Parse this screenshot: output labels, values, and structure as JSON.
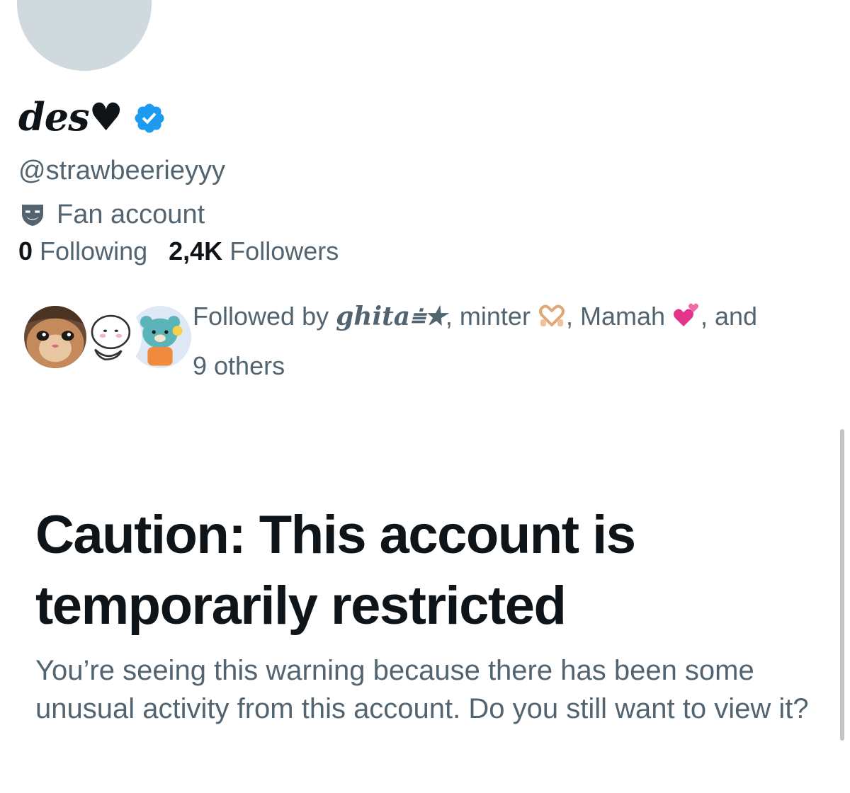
{
  "profile": {
    "display_name": "des♥",
    "handle": "@strawbeerieyyy",
    "category": "Fan account",
    "icons": {
      "verified": "verified-badge-icon",
      "category": "theater-mask-icon"
    },
    "colors": {
      "verified_blue": "#1d9bf0",
      "secondary_text": "#536471",
      "primary_text": "#0f1419",
      "avatar_placeholder": "#cfd9de"
    }
  },
  "stats": {
    "following_count": "0",
    "following_label": "Following",
    "followers_count": "2,4K",
    "followers_label": "Followers"
  },
  "followed_by": {
    "prefix": "Followed by ",
    "name1": "ghita⩧★",
    "sep1": ", minter ",
    "emoji1": "heart-hands-emoji",
    "sep2": ", Mamah ",
    "emoji2": "two-hearts-emoji",
    "suffix": ", and",
    "others": "9 others"
  },
  "warning": {
    "title": "Caution: This account is temporarily restricted",
    "body": "You’re seeing this warning because there has been some unusual activity from this account. Do you still want to view it?"
  }
}
